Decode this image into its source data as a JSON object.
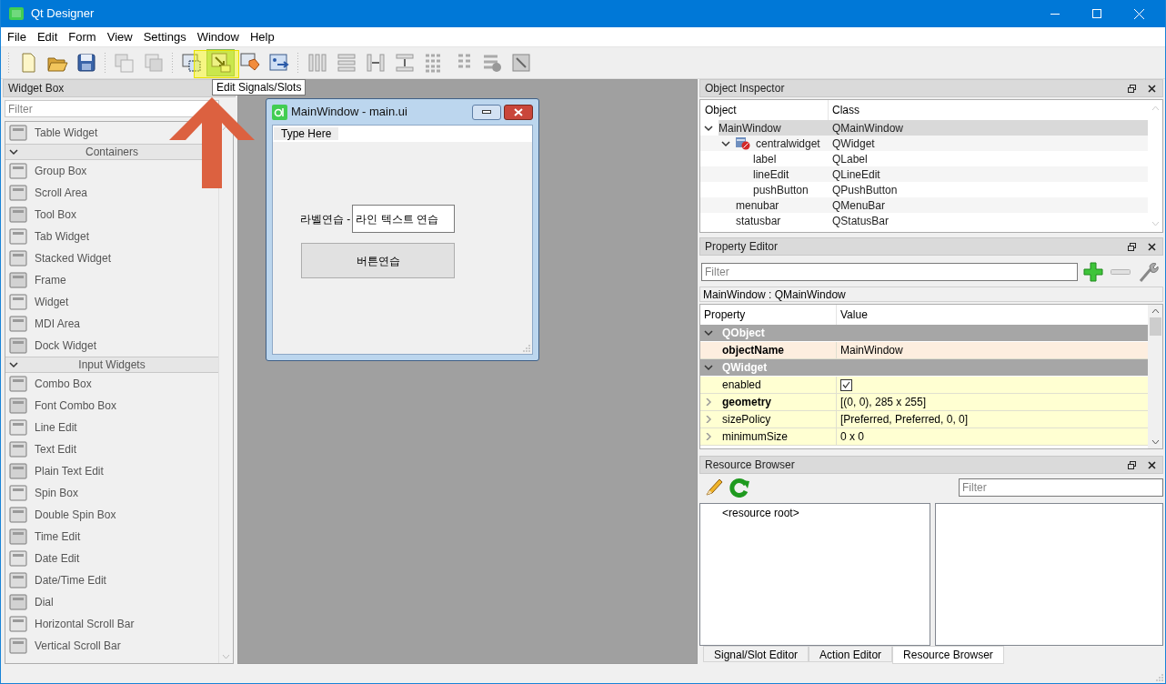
{
  "window": {
    "title": "Qt Designer"
  },
  "menu": [
    "File",
    "Edit",
    "Form",
    "View",
    "Settings",
    "Window",
    "Help"
  ],
  "edit_modes": [
    {
      "selected": false
    },
    {
      "selected": true
    },
    {
      "selected": false
    },
    {
      "selected": false
    }
  ],
  "tooltip": "Edit Signals/Slots",
  "widget_box": {
    "title": "Widget Box",
    "filter_placeholder": "Filter",
    "items": [
      {
        "kind": "item",
        "label": "Table Widget"
      },
      {
        "kind": "category",
        "label": "Containers",
        "expanded": true
      },
      {
        "kind": "item",
        "label": "Group Box"
      },
      {
        "kind": "item",
        "label": "Scroll Area"
      },
      {
        "kind": "item",
        "label": "Tool Box"
      },
      {
        "kind": "item",
        "label": "Tab Widget"
      },
      {
        "kind": "item",
        "label": "Stacked Widget"
      },
      {
        "kind": "item",
        "label": "Frame"
      },
      {
        "kind": "item",
        "label": "Widget"
      },
      {
        "kind": "item",
        "label": "MDI Area"
      },
      {
        "kind": "item",
        "label": "Dock Widget"
      },
      {
        "kind": "category",
        "label": "Input Widgets",
        "expanded": true
      },
      {
        "kind": "item",
        "label": "Combo Box"
      },
      {
        "kind": "item",
        "label": "Font Combo Box"
      },
      {
        "kind": "item",
        "label": "Line Edit"
      },
      {
        "kind": "item",
        "label": "Text Edit"
      },
      {
        "kind": "item",
        "label": "Plain Text Edit"
      },
      {
        "kind": "item",
        "label": "Spin Box"
      },
      {
        "kind": "item",
        "label": "Double Spin Box"
      },
      {
        "kind": "item",
        "label": "Time Edit"
      },
      {
        "kind": "item",
        "label": "Date Edit"
      },
      {
        "kind": "item",
        "label": "Date/Time Edit"
      },
      {
        "kind": "item",
        "label": "Dial"
      },
      {
        "kind": "item",
        "label": "Horizontal Scroll Bar"
      },
      {
        "kind": "item",
        "label": "Vertical Scroll Bar"
      }
    ]
  },
  "form_window": {
    "title": "MainWindow - main.ui",
    "menu_placeholder": "Type Here",
    "label": "라벨연습 -",
    "line_edit": "라인 텍스트 연습",
    "button": "버튼연습"
  },
  "object_inspector": {
    "title": "Object Inspector",
    "columns": [
      "Object",
      "Class"
    ],
    "rows": [
      {
        "object": "MainWindow",
        "class": "QMainWindow",
        "selected": true,
        "expanded": true,
        "children": [
          {
            "object": "centralwidget",
            "class": "QWidget",
            "selected": false,
            "expanded": true,
            "children": [
              {
                "object": "label",
                "class": "QLabel",
                "selected": false
              },
              {
                "object": "lineEdit",
                "class": "QLineEdit",
                "selected": false
              },
              {
                "object": "pushButton",
                "class": "QPushButton",
                "selected": false
              }
            ]
          },
          {
            "object": "menubar",
            "class": "QMenuBar",
            "selected": false
          },
          {
            "object": "statusbar",
            "class": "QStatusBar",
            "selected": false
          }
        ]
      }
    ]
  },
  "property_editor": {
    "title": "Property Editor",
    "filter_placeholder": "Filter",
    "object_label": "MainWindow : QMainWindow",
    "columns": [
      "Property",
      "Value"
    ],
    "groups": [
      {
        "name": "QObject",
        "expanded": true,
        "color": "#fdeedf",
        "properties": [
          {
            "kind": "text",
            "name": "objectName",
            "value": "MainWindow",
            "modified": true,
            "expandable": false
          }
        ]
      },
      {
        "name": "QWidget",
        "expanded": true,
        "color": "#ffffd2",
        "properties": [
          {
            "kind": "checkbox",
            "name": "enabled",
            "checked": true,
            "modified": false,
            "expandable": false
          },
          {
            "kind": "text",
            "name": "geometry",
            "value": "[(0, 0), 285 x 255]",
            "modified": true,
            "expandable": true
          },
          {
            "kind": "text",
            "name": "sizePolicy",
            "value": "[Preferred, Preferred, 0, 0]",
            "modified": false,
            "expandable": true
          },
          {
            "kind": "text",
            "name": "minimumSize",
            "value": "0 x 0",
            "modified": false,
            "expandable": true
          }
        ]
      }
    ]
  },
  "resource_browser": {
    "title": "Resource Browser",
    "filter_placeholder": "Filter",
    "tree": [
      "<resource root>"
    ]
  },
  "bottom_tabs": [
    {
      "label": "Signal/Slot Editor",
      "selected": false
    },
    {
      "label": "Action Editor",
      "selected": false
    },
    {
      "label": "Resource Browser",
      "selected": true
    }
  ]
}
